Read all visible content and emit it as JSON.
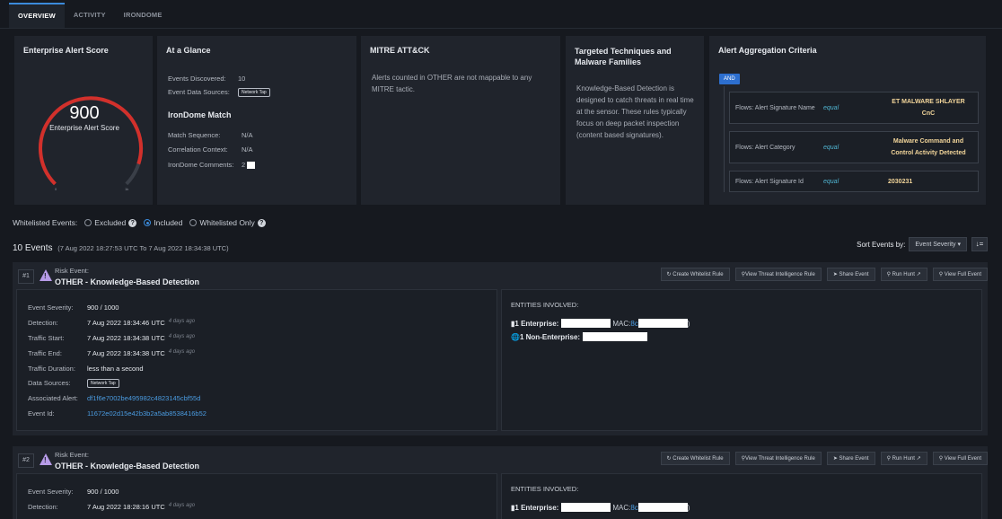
{
  "tabs": [
    {
      "label": "OVERVIEW"
    },
    {
      "label": "ACTIVITY"
    },
    {
      "label": "IRONDOME"
    }
  ],
  "score_card": {
    "title": "Enterprise Alert Score",
    "value": "900",
    "label": "Enterprise Alert Score",
    "min": "0",
    "max": "1k",
    "fraction": 0.9
  },
  "glance": {
    "title": "At a Glance",
    "events_discovered_label": "Events Discovered:",
    "events_discovered": "10",
    "data_sources_label": "Event Data Sources:",
    "data_source": "Network Tap",
    "irondome_title": "IronDome Match",
    "match_seq_label": "Match Sequence:",
    "match_seq": "N/A",
    "corr_label": "Correlation Context:",
    "corr": "N/A",
    "comments_label": "IronDome Comments:",
    "comments": "2"
  },
  "mitre": {
    "title": "MITRE ATT&CK",
    "text": "Alerts counted in OTHER are not mappable to any MITRE tactic."
  },
  "targeted": {
    "title_line1": "Targeted Techniques and",
    "title_line2": "Malware Families",
    "text": "Knowledge-Based Detection is designed to catch threats in real time at the sensor. These rules typically focus on deep packet inspection (content based signatures)."
  },
  "aggregation": {
    "title": "Alert Aggregation Criteria",
    "and_label": "AND",
    "criteria": [
      {
        "field": "Flows: Alert Signature Name",
        "op": "equal",
        "value_line1": "ET MALWARE SHLAYER",
        "value_line2": "CnC"
      },
      {
        "field": "Flows: Alert Category",
        "op": "equal",
        "value_line1": "Malware Command and",
        "value_line2": "Control Activity Detected"
      },
      {
        "field": "Flows: Alert Signature Id",
        "op": "equal",
        "value_line1": "2030231",
        "value_line2": ""
      }
    ]
  },
  "whitelist": {
    "label": "Whitelisted Events:",
    "options": [
      {
        "label": "Excluded",
        "selected": false
      },
      {
        "label": "Included",
        "selected": true
      },
      {
        "label": "Whitelisted Only",
        "selected": false
      }
    ]
  },
  "events_header": {
    "count": "10 Events",
    "range": "(7 Aug 2022 18:27:53 UTC To 7 Aug 2022 18:34:38 UTC)",
    "sort_label": "Sort Events by:",
    "sort_value": "Event Severity",
    "sort_dir_icon": "↓="
  },
  "actions": {
    "whitelist": "Create Whitelist Rule",
    "threat": "View Threat Intelligence Rule",
    "share": "Share Event",
    "hunt": "Run Hunt",
    "full": "View Full Event"
  },
  "events": [
    {
      "num": "#1",
      "type": "Risk Event:",
      "title": "OTHER - Knowledge-Based Detection",
      "severity_label": "Event Severity:",
      "severity": "900 / 1000",
      "detection_label": "Detection:",
      "detection": "7 Aug 2022 18:34:46 UTC",
      "detection_ago": "4 days ago",
      "tstart_label": "Traffic Start:",
      "tstart": "7 Aug 2022 18:34:38 UTC",
      "tstart_ago": "4 days ago",
      "tend_label": "Traffic End:",
      "tend": "7 Aug 2022 18:34:38 UTC",
      "tend_ago": "4 days ago",
      "duration_label": "Traffic Duration:",
      "duration": "less than a second",
      "sources_label": "Data Sources:",
      "source": "Network Tap",
      "alert_label": "Associated Alert:",
      "alert": "df1f6e7002be495982c4823145cbf55d",
      "id_label": "Event Id:",
      "id": "11672e02d15e42b3b2a5ab8538416b52",
      "entities_title": "ENTITIES INVOLVED:",
      "enterprise": "1 Enterprise:",
      "mac_label": "MAC:",
      "mac": "8c",
      "non_enterprise": "1 Non-Enterprise:"
    },
    {
      "num": "#2",
      "type": "Risk Event:",
      "title": "OTHER - Knowledge-Based Detection",
      "severity_label": "Event Severity:",
      "severity": "900 / 1000",
      "detection_label": "Detection:",
      "detection": "7 Aug 2022 18:28:16 UTC",
      "detection_ago": "4 days ago",
      "entities_title": "ENTITIES INVOLVED:",
      "enterprise": "1 Enterprise:",
      "mac_label": "MAC:",
      "mac": "8c"
    }
  ]
}
